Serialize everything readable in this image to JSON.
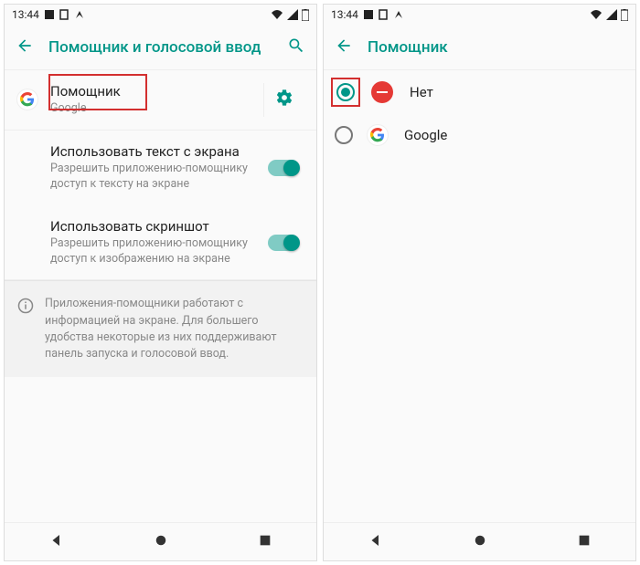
{
  "status": {
    "time": "13:44"
  },
  "screen1": {
    "title": "Помощник и голосовой ввод",
    "assist": {
      "title": "Помощник",
      "subtitle": "Google"
    },
    "useText": {
      "title": "Использовать текст с экрана",
      "subtitle": "Разрешить приложению-помощнику доступ к тексту на экране"
    },
    "useShot": {
      "title": "Использовать скриншот",
      "subtitle": "Разрешить приложению-помощнику доступ к изображению на экране"
    },
    "info": "Приложения-помощники работают с информацией на экране. Для большего удобства некоторые из них поддерживают панель запуска и голосовой ввод."
  },
  "screen2": {
    "title": "Помощник",
    "optNone": "Нет",
    "optGoogle": "Google"
  }
}
